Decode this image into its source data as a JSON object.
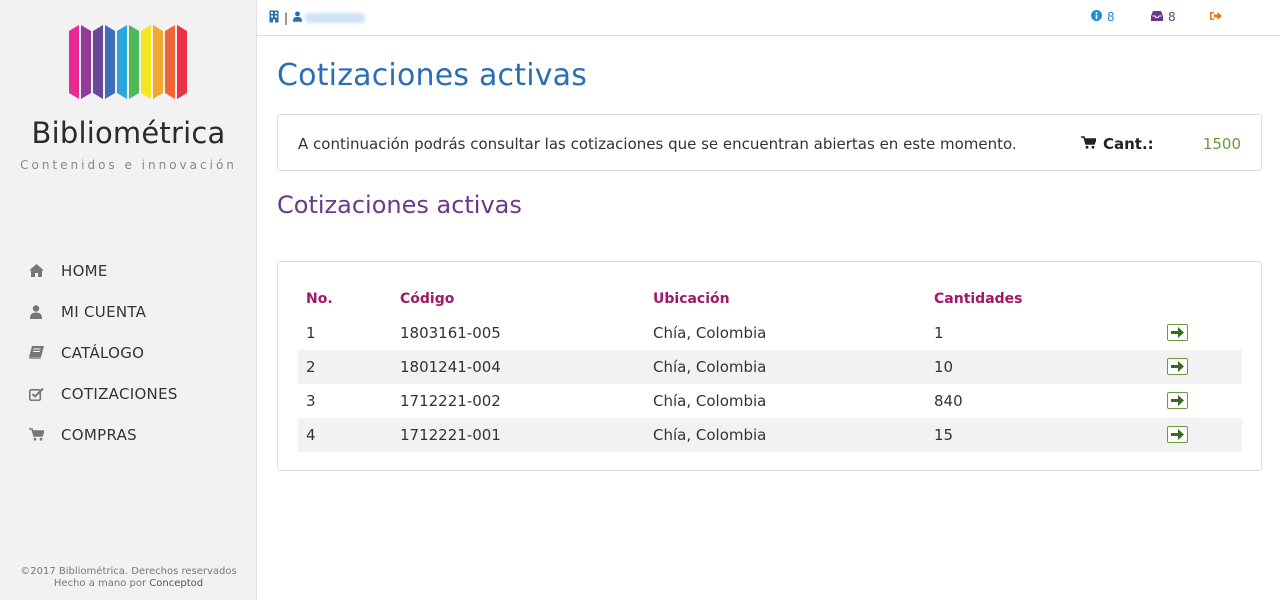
{
  "brand": {
    "name": "Bibliométrica",
    "tagline": "Contenidos e innovación",
    "bar_colors": [
      "#e7198a",
      "#8a2c8f",
      "#5a3b94",
      "#2f62b4",
      "#1aa0d8",
      "#3fb54a",
      "#f6e50f",
      "#f4a11d",
      "#ef5a25",
      "#e8213c"
    ]
  },
  "nav": {
    "items": [
      {
        "label": "HOME",
        "icon": "home-icon"
      },
      {
        "label": "MI CUENTA",
        "icon": "user-icon"
      },
      {
        "label": "CATÁLOGO",
        "icon": "book-icon"
      },
      {
        "label": "COTIZACIONES",
        "icon": "checkbox-icon"
      },
      {
        "label": "COMPRAS",
        "icon": "cart-icon"
      }
    ]
  },
  "footer": {
    "copyright": "©2017 Bibliométrica. Derechos reservados",
    "credit_prefix": "Hecho a mano por",
    "credit_link": "Conceptod"
  },
  "topbar": {
    "separator": "|",
    "user_name": "",
    "info_count": "8",
    "inbox_count": "8",
    "colors": {
      "info": "#1a8fd6",
      "inbox": "#6a3a8a",
      "logout": "#e07b1a"
    }
  },
  "main": {
    "page_title": "Cotizaciones activas",
    "info_text": "A continuación podrás consultar las cotizaciones que se encuentran abiertas en este momento.",
    "cant_label": "Cant.:",
    "cant_value": "1500",
    "section_title": "Cotizaciones activas"
  },
  "table": {
    "headers": [
      "No.",
      "Código",
      "Ubicación",
      "Cantidades"
    ],
    "rows": [
      {
        "no": "1",
        "code": "1803161-005",
        "location": "Chía, Colombia",
        "qty": "1"
      },
      {
        "no": "2",
        "code": "1801241-004",
        "location": "Chía, Colombia",
        "qty": "10"
      },
      {
        "no": "3",
        "code": "1712221-002",
        "location": "Chía, Colombia",
        "qty": "840"
      },
      {
        "no": "4",
        "code": "1712221-001",
        "location": "Chía, Colombia",
        "qty": "15"
      }
    ],
    "colors": {
      "header": "#a2176a",
      "action": "#6a9a3a",
      "stripe": "#f2f2f2"
    }
  }
}
